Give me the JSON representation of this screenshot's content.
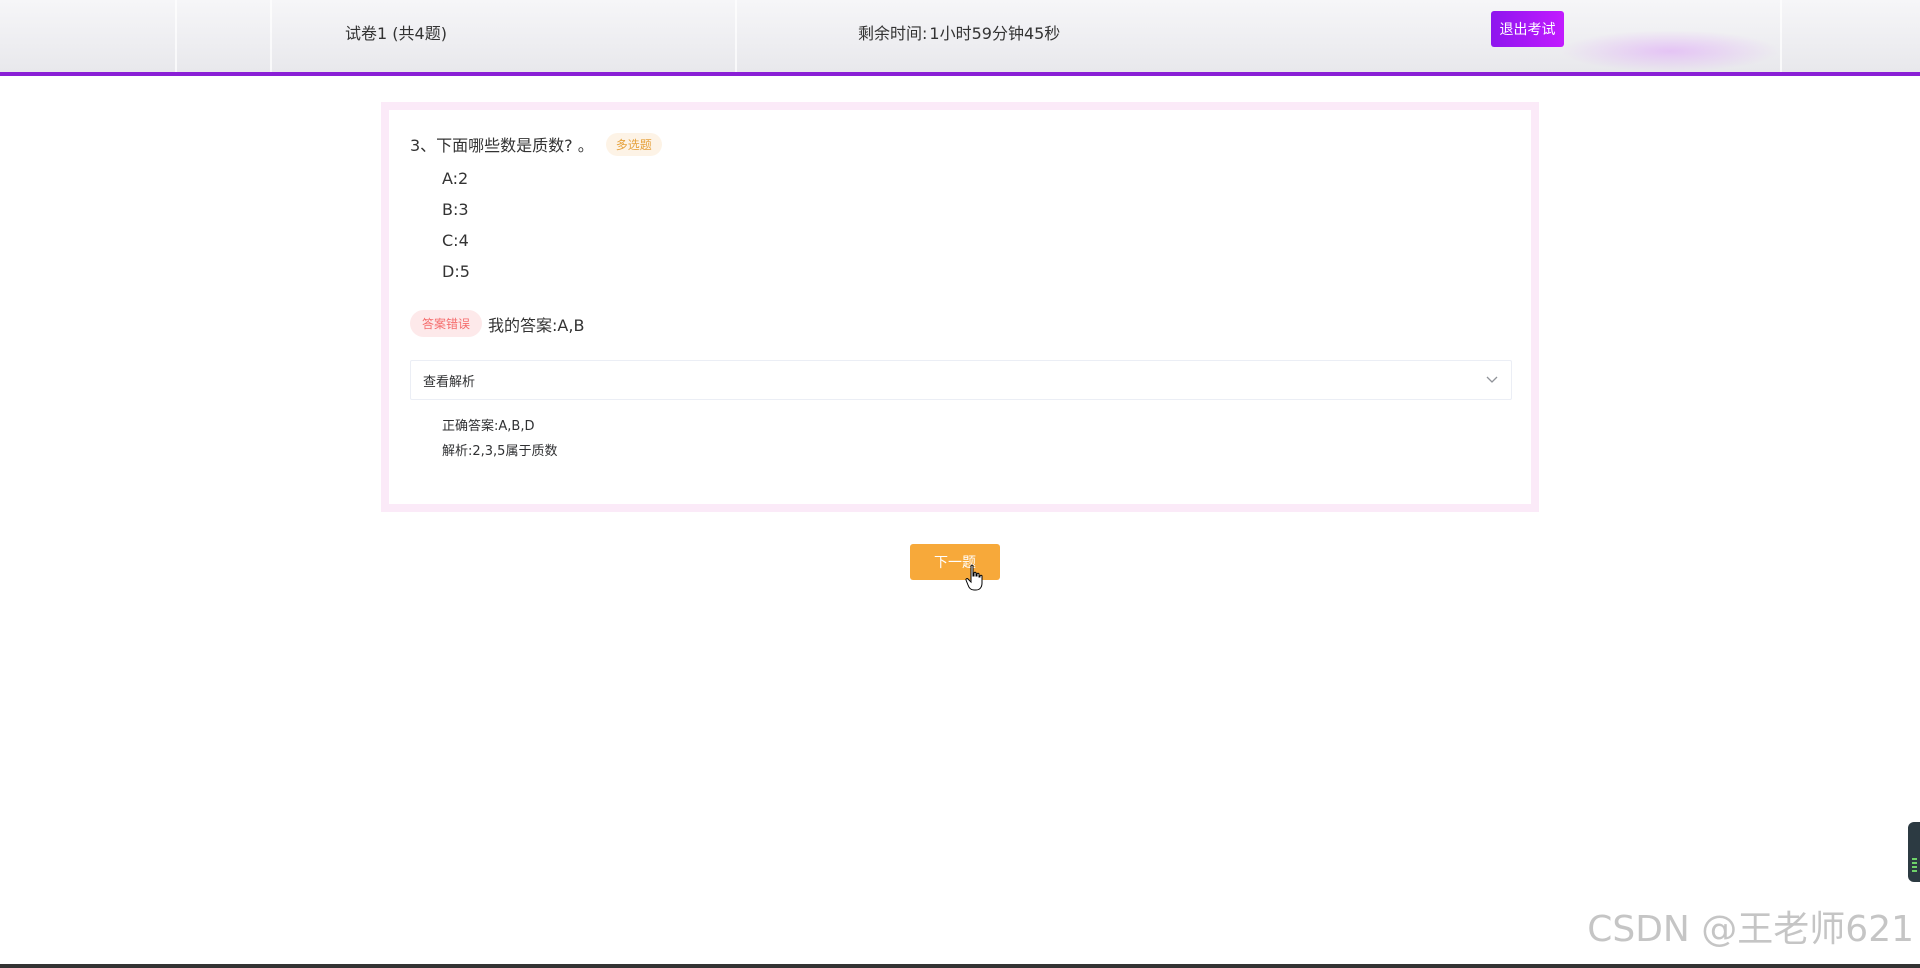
{
  "header": {
    "paper_title": "试卷1 (共4题)",
    "timer_label": "剩余时间:",
    "timer_value": "1小时59分钟45秒",
    "exit_label": "退出考试"
  },
  "question": {
    "stem": "3、下面哪些数是质数? 。",
    "type_tag": "多选题",
    "options": [
      "A:2",
      "B:3",
      "C:4",
      "D:5"
    ],
    "result_tag": "答案错误",
    "my_answer": "我的答案:A,B",
    "analysis_toggle": "查看解析",
    "correct_answer": "正确答案:A,B,D",
    "explanation": "解析:2,3,5属于质数"
  },
  "footer": {
    "next_label": "下一题",
    "watermark": "CSDN @王老师621"
  },
  "colors": {
    "accent": "#8a1fd6",
    "next_button": "#f7a93a",
    "wrong": "#f56c6c",
    "tag": "#e6a23c"
  }
}
